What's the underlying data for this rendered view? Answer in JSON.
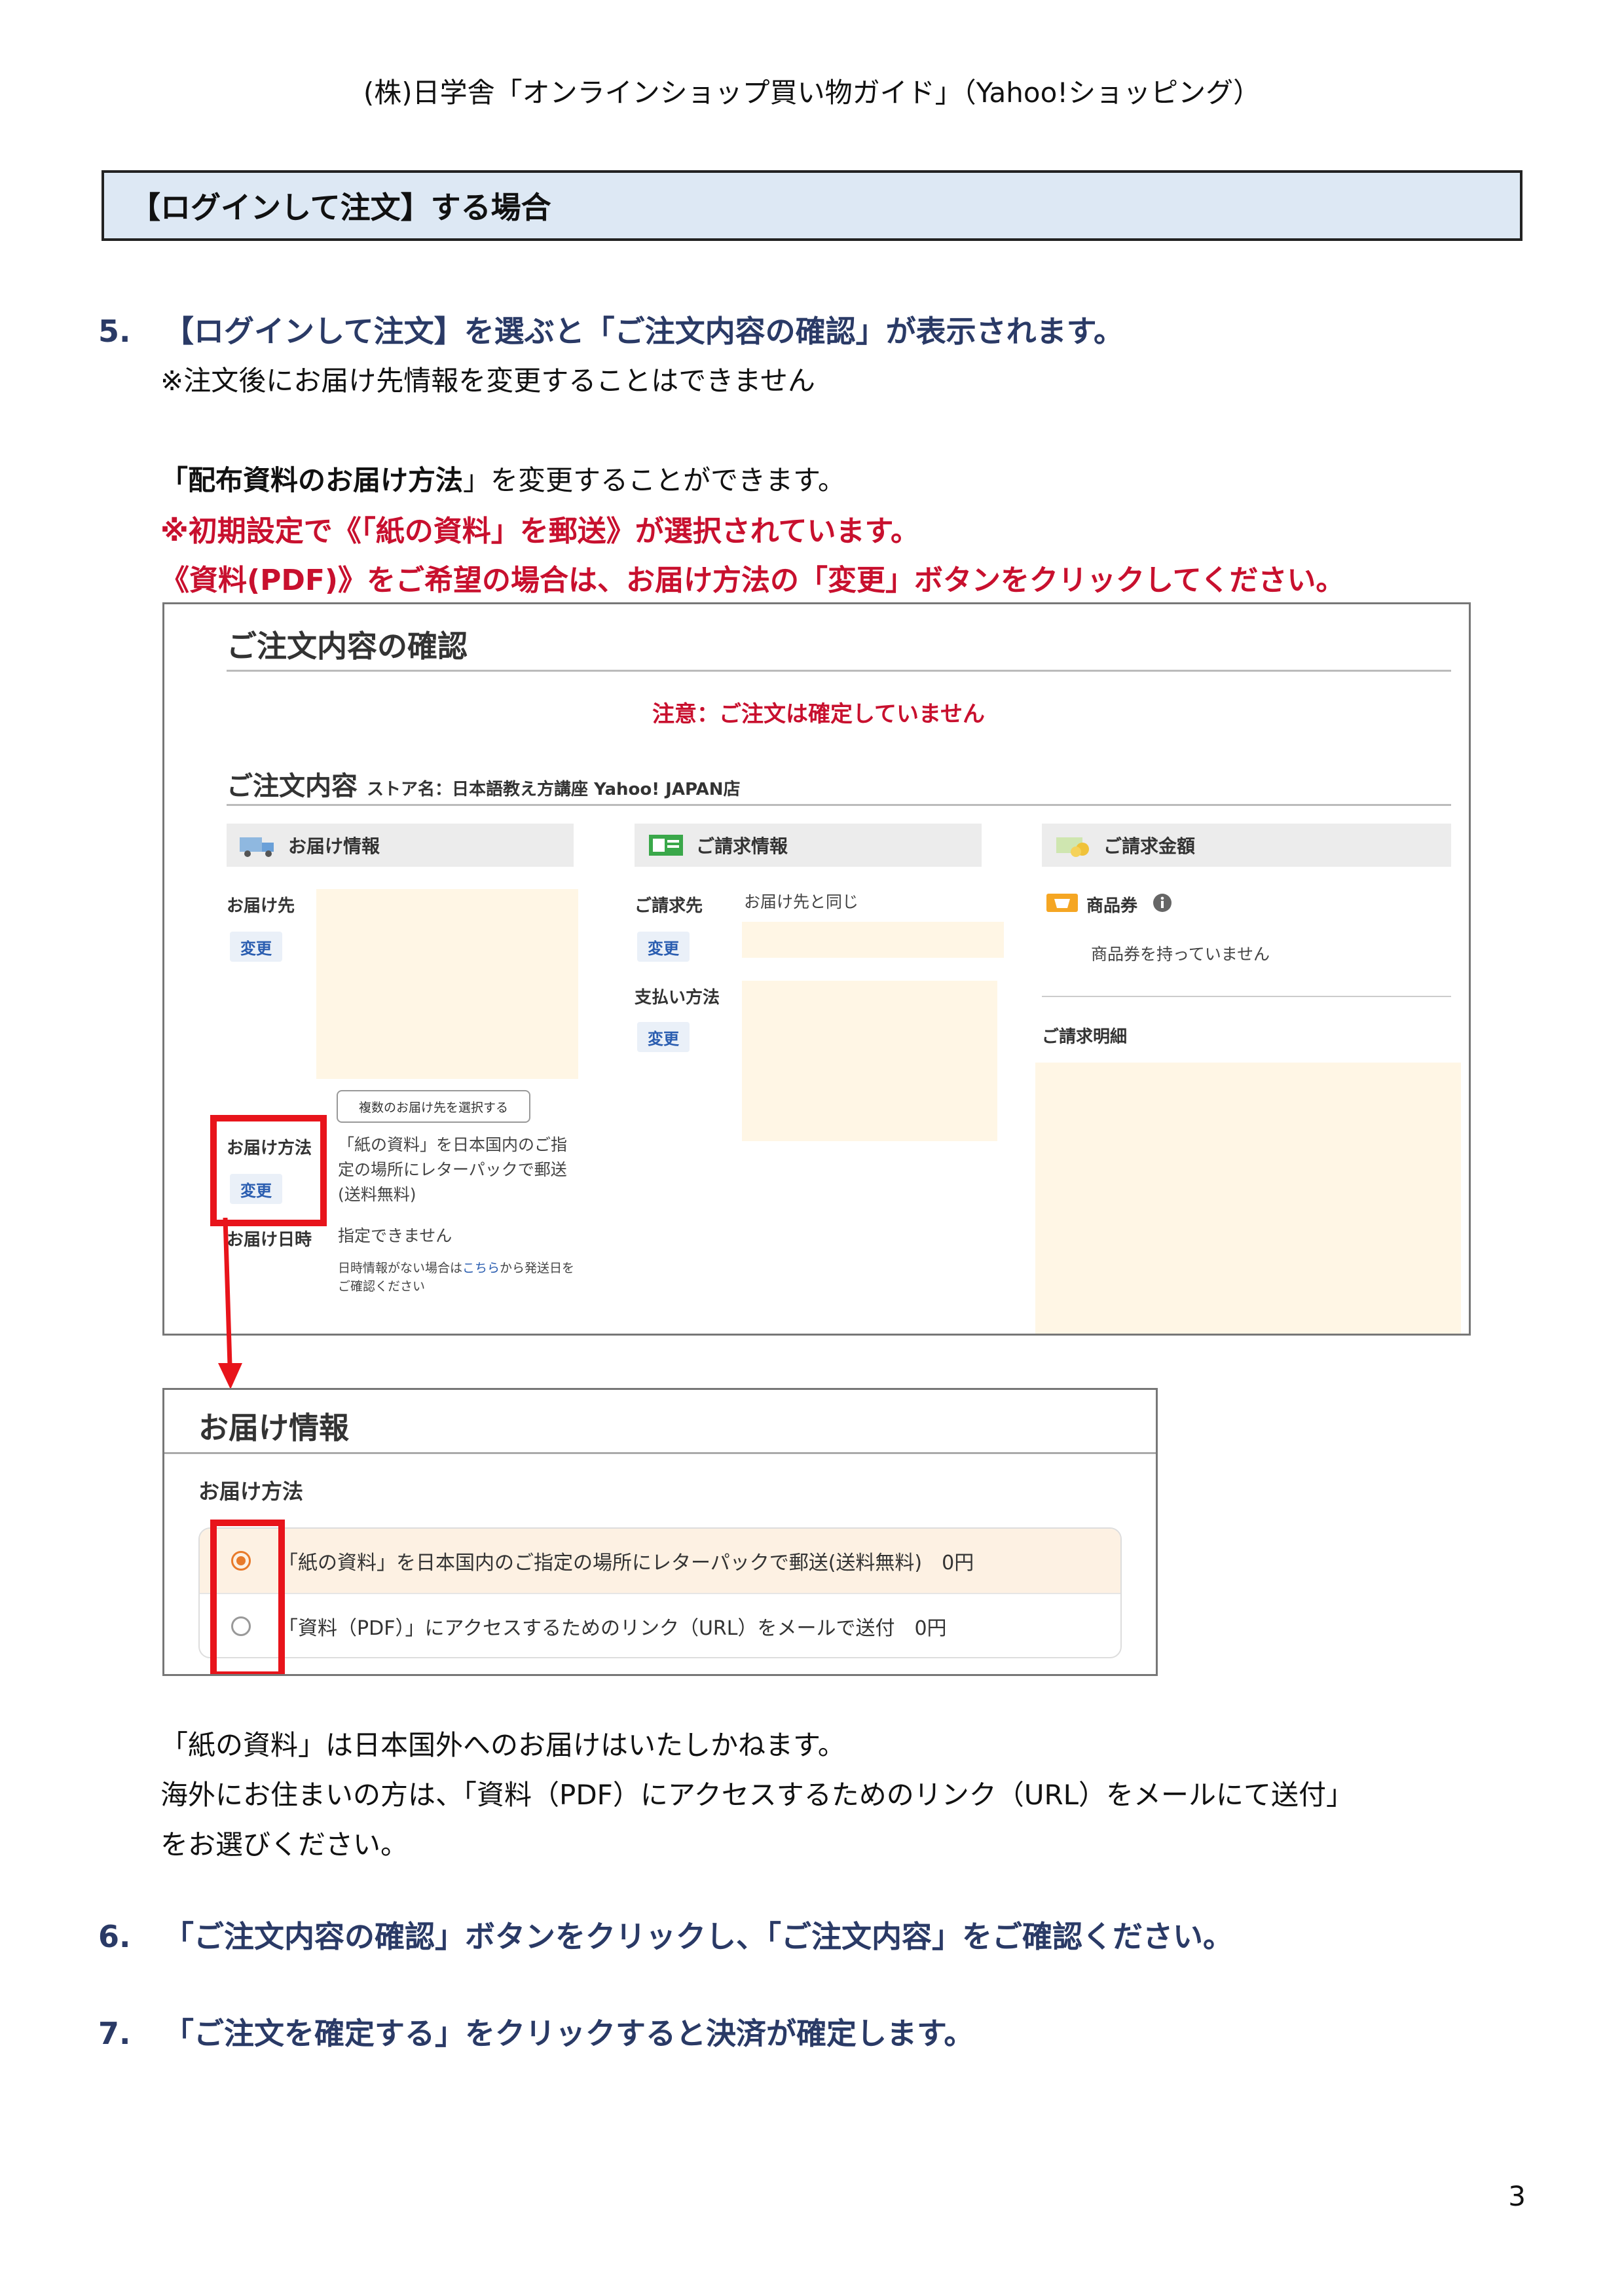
{
  "header": {
    "title": "(株)日学舎「オンラインショップ買い物ガイド」（Yahoo!ショッピング）"
  },
  "section": {
    "heading": "【ログインして注文】する場合"
  },
  "steps": {
    "s5": {
      "num": "5.",
      "text": "【ログインして注文】を選ぶと「ご注文内容の確認」が表示されます。"
    },
    "s5_note": "※注文後にお届け先情報を変更することはできません",
    "delivery_bold": "「配布資料のお届け方法",
    "delivery_rest": "」を変更することができます。",
    "red1": "※初期設定で《「紙の資料」を郵送》が選択されています。",
    "red2": "《資料(PDF)》をご希望の場合は、お届け方法の「変更」ボタンをクリックしてください。",
    "s6": {
      "num": "6.",
      "text": "「ご注文内容の確認」ボタンをクリックし、「ご注文内容」をご確認ください。"
    },
    "s7": {
      "num": "7.",
      "text": "「ご注文を確定する」をクリックすると決済が確定します。"
    }
  },
  "shot1": {
    "title": "ご注文内容の確認",
    "notice": "注意：ご注文は確定していません",
    "order_content": "ご注文内容",
    "store": "ストア名：日本語教え方講座 Yahoo! JAPAN店",
    "delivery_info": "お届け情報",
    "billing_info": "ご請求情報",
    "billing_amount": "ご請求金額",
    "destination_label": "お届け先",
    "change": "変更",
    "multi_dest_button": "複数のお届け先を選択する",
    "method_label": "お届け方法",
    "method_text": "「紙の資料」を日本国内のご指定の場所にレターパックで郵送(送料無料)",
    "date_label": "お届け日時",
    "date_text": "指定できません",
    "date_note_pre": "日時情報がない場合は",
    "date_note_link": "こちら",
    "date_note_post": "から発送日をご確認ください",
    "bill_to_label": "ご請求先",
    "bill_to_value": "お届け先と同じ",
    "payment_label": "支払い方法",
    "coupon_label": "商品券",
    "coupon_text": "商品券を持っていません",
    "bill_detail": "ご請求明細"
  },
  "shot2": {
    "title": "お届け情報",
    "subtitle": "お届け方法",
    "options": [
      {
        "label": "「紙の資料」を日本国内のご指定の場所にレターパックで郵送(送料無料)　0円",
        "selected": true
      },
      {
        "label": "「資料（PDF）」にアクセスするためのリンク（URL）をメールで送付　0円",
        "selected": false
      }
    ]
  },
  "notes": {
    "line1": "「紙の資料」は日本国外へのお届けはいたしかねます。",
    "line2": "海外にお住まいの方は、「資料（PDF）にアクセスするためのリンク（URL）をメールにて送付」",
    "line3": "をお選びください。"
  },
  "page_number": "3",
  "colors": {
    "accent_red": "#c8102e",
    "heading_navy": "#2a3a66",
    "box_blue": "#dde8f4",
    "highlight_red": "#e8141b"
  }
}
